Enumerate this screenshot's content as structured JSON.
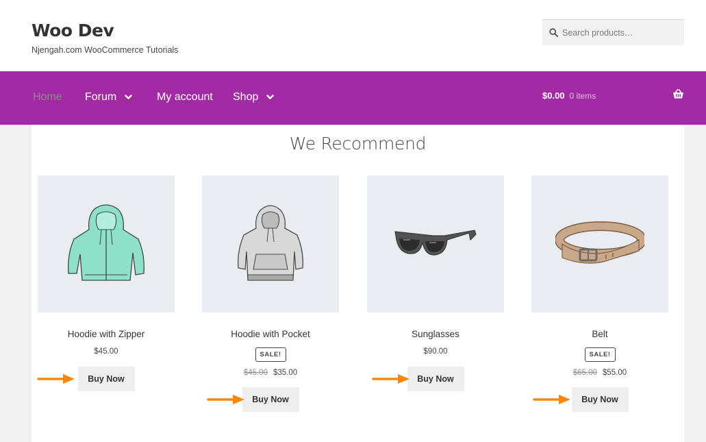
{
  "header": {
    "site_title": "Woo Dev",
    "site_description": "Njengah.com WooCommerce Tutorials",
    "search_placeholder": "Search products…"
  },
  "nav": {
    "items": [
      {
        "label": "Home",
        "has_dropdown": false,
        "state": "current"
      },
      {
        "label": "Forum",
        "has_dropdown": true
      },
      {
        "label": "My account",
        "has_dropdown": false
      },
      {
        "label": "Shop",
        "has_dropdown": true
      }
    ],
    "cart": {
      "amount": "$0.00",
      "count": "0 items"
    }
  },
  "section": {
    "title": "We Recommend"
  },
  "products": [
    {
      "name": "Hoodie with Zipper",
      "sale_badge": "",
      "regular_price": "",
      "price": "$45.00",
      "button": "Buy Now",
      "image": "hoodie-zipper"
    },
    {
      "name": "Hoodie with Pocket",
      "sale_badge": "SALE!",
      "regular_price": "$45.00",
      "price": "$35.00",
      "button": "Buy Now",
      "image": "hoodie-pocket"
    },
    {
      "name": "Sunglasses",
      "sale_badge": "",
      "regular_price": "",
      "price": "$90.00",
      "button": "Buy Now",
      "image": "sunglasses"
    },
    {
      "name": "Belt",
      "sale_badge": "SALE!",
      "regular_price": "$65.00",
      "price": "$55.00",
      "button": "Buy Now",
      "image": "belt"
    }
  ],
  "colors": {
    "nav_background": "#a22ba4",
    "annotation_arrow": "#f7870d",
    "product_background": "#e9edf1"
  }
}
